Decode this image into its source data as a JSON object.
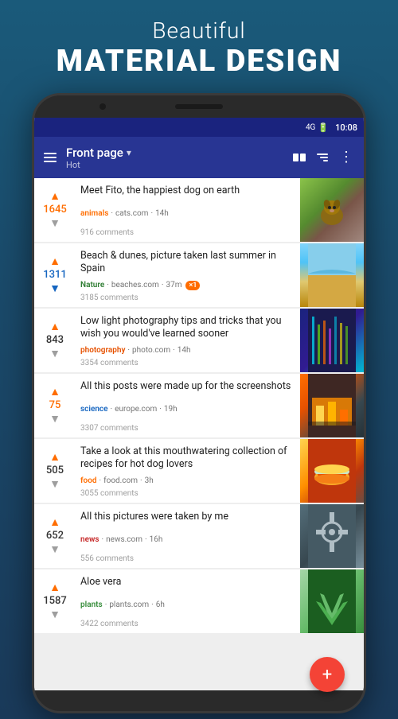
{
  "hero": {
    "line1": "Beautiful",
    "line2_light": "MATERIAL ",
    "line2_bold": "DESIGN"
  },
  "status_bar": {
    "signal": "4G",
    "battery_icon": "🔋",
    "time": "10:08"
  },
  "app_bar": {
    "title": "Front page",
    "subtitle": "Hot",
    "dropdown_icon": "▾",
    "menu_icon": "☰"
  },
  "posts": [
    {
      "id": 1,
      "title": "Meet Fito, the happiest dog on earth",
      "category": "animals",
      "category_class": "cat-animals",
      "source": "cats.com",
      "age": "14h",
      "comments": "916 comments",
      "vote_count": "1645",
      "vote_class": "orange",
      "arrow_up_class": "arrow-up",
      "arrow_down_class": "arrow-down",
      "thumb_class": "thumb-dog"
    },
    {
      "id": 2,
      "title": "Beach & dunes, picture taken last summer in Spain",
      "category": "Nature",
      "category_class": "cat-nature",
      "source": "beaches.com",
      "age": "37m",
      "comments": "3185 comments",
      "vote_count": "1311",
      "vote_class": "blue",
      "arrow_up_class": "arrow-up",
      "arrow_down_class": "arrow-down blue",
      "has_badge": true,
      "badge_text": "×1",
      "thumb_class": "thumb-beach"
    },
    {
      "id": 3,
      "title": "Low light photography tips and tricks that you wish you would've learned sooner",
      "category": "photography",
      "category_class": "cat-photography",
      "source": "photo.com",
      "age": "14h",
      "comments": "3354 comments",
      "vote_count": "843",
      "vote_class": "",
      "arrow_up_class": "arrow-up",
      "arrow_down_class": "arrow-down",
      "thumb_class": "thumb-photo"
    },
    {
      "id": 4,
      "title": "All this posts were made up for the screenshots",
      "category": "science",
      "category_class": "cat-science",
      "source": "europe.com",
      "age": "19h",
      "comments": "3307 comments",
      "vote_count": "75",
      "vote_class": "orange",
      "arrow_up_class": "arrow-up",
      "arrow_down_class": "arrow-down",
      "thumb_class": "thumb-science"
    },
    {
      "id": 5,
      "title": "Take a look at this mouthwatering collection of recipes for hot dog lovers",
      "category": "food",
      "category_class": "cat-food",
      "source": "food.com",
      "age": "3h",
      "comments": "3055 comments",
      "vote_count": "505",
      "vote_class": "",
      "arrow_up_class": "arrow-up",
      "arrow_down_class": "arrow-down",
      "thumb_class": "thumb-food"
    },
    {
      "id": 6,
      "title": "All this pictures were taken by me",
      "category": "news",
      "category_class": "cat-news",
      "source": "news.com",
      "age": "16h",
      "comments": "556 comments",
      "vote_count": "652",
      "vote_class": "",
      "arrow_up_class": "arrow-up",
      "arrow_down_class": "arrow-down",
      "thumb_class": "thumb-news"
    },
    {
      "id": 7,
      "title": "Aloe vera",
      "category": "plants",
      "category_class": "cat-plants",
      "source": "plants.com",
      "age": "6h",
      "comments": "3422 comments",
      "vote_count": "1587",
      "vote_class": "",
      "arrow_up_class": "arrow-up",
      "arrow_down_class": "arrow-down",
      "thumb_class": "thumb-aloe"
    }
  ],
  "fab": {
    "label": "+"
  }
}
